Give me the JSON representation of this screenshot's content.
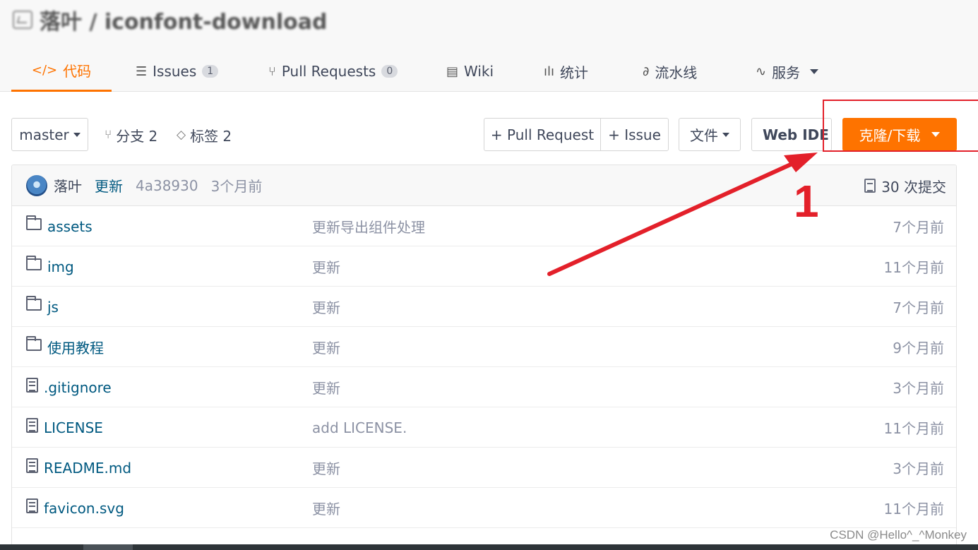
{
  "repo": {
    "title": "落叶 / iconfont-download"
  },
  "tabs": [
    {
      "icon": "</>",
      "label": "代码",
      "active": true
    },
    {
      "icon": "☰",
      "label": "Issues",
      "badge": "1"
    },
    {
      "icon": "⑂",
      "label": "Pull Requests",
      "badge": "0"
    },
    {
      "icon": "▤",
      "label": "Wiki"
    },
    {
      "icon": "ılı",
      "label": "统计"
    },
    {
      "icon": "∂",
      "label": "流水线"
    },
    {
      "icon": "∿",
      "label": "服务"
    }
  ],
  "toolbar": {
    "branch": "master",
    "branches": "分支 2",
    "tags": "标签 2",
    "pull_request": "+ Pull Request",
    "issue": "+ Issue",
    "files": "文件",
    "web_ide": "Web IDE",
    "clone_download": "克隆/下载"
  },
  "commit": {
    "author": "落叶",
    "message": "更新",
    "hash": "4a38930",
    "time": "3个月前",
    "count": "30 次提交"
  },
  "files": [
    {
      "type": "folder",
      "name": "assets",
      "message": "更新导出组件处理",
      "time": "7个月前"
    },
    {
      "type": "folder",
      "name": "img",
      "message": "更新",
      "time": "11个月前"
    },
    {
      "type": "folder",
      "name": "js",
      "message": "更新",
      "time": "7个月前"
    },
    {
      "type": "folder",
      "name": "使用教程",
      "message": "更新",
      "time": "9个月前"
    },
    {
      "type": "file",
      "name": ".gitignore",
      "message": "更新",
      "time": "3个月前"
    },
    {
      "type": "file",
      "name": "LICENSE",
      "message": "add LICENSE.",
      "time": "11个月前"
    },
    {
      "type": "file",
      "name": "README.md",
      "message": "更新",
      "time": "3个月前"
    },
    {
      "type": "file",
      "name": "favicon.svg",
      "message": "更新",
      "time": "11个月前"
    }
  ],
  "annotation": {
    "number": "1",
    "color": "#e3202a"
  },
  "watermark": "CSDN @Hello^_^Monkey",
  "colors": {
    "accent": "#fe7300",
    "link": "#005980",
    "muted": "#8c92a4"
  }
}
